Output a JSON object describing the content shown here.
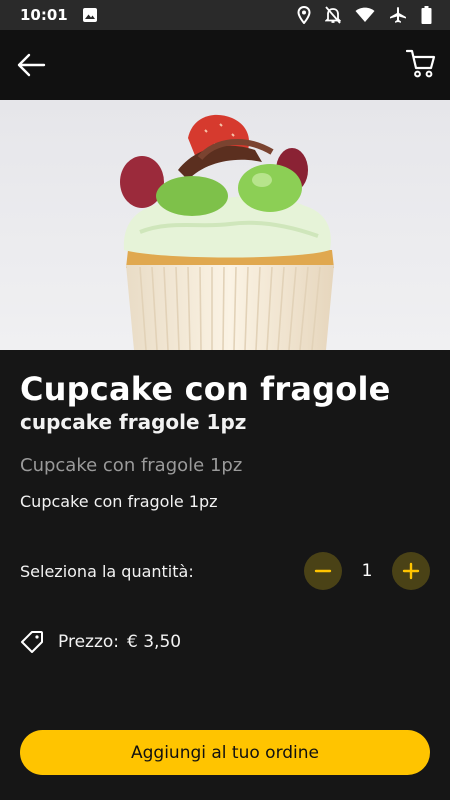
{
  "status_bar": {
    "time": "10:01",
    "icons": [
      "image-icon",
      "location-icon",
      "notifications-off-icon",
      "wifi-icon",
      "airplane-icon",
      "battery-icon"
    ]
  },
  "app_bar": {
    "back_icon": "arrow-left-icon",
    "cart_icon": "cart-icon"
  },
  "product": {
    "image_description_icon": "cupcake-image",
    "title": "Cupcake con fragole",
    "subtitle": "cupcake fragole 1pz",
    "description_gray": "Cupcake con fragole 1pz",
    "description": "Cupcake con fragole 1pz"
  },
  "quantity": {
    "label": "Seleziona la quantità:",
    "value": "1",
    "minus_symbol": "−",
    "plus_symbol": "+"
  },
  "price": {
    "label": "Prezzo:",
    "value": "€ 3,50",
    "icon": "tag-icon"
  },
  "cta": {
    "label": "Aggiungi al tuo ordine"
  },
  "colors": {
    "background": "#161616",
    "accent": "#ffc400",
    "stepper_bg": "#4a4216",
    "dot": "#1a73e8"
  }
}
